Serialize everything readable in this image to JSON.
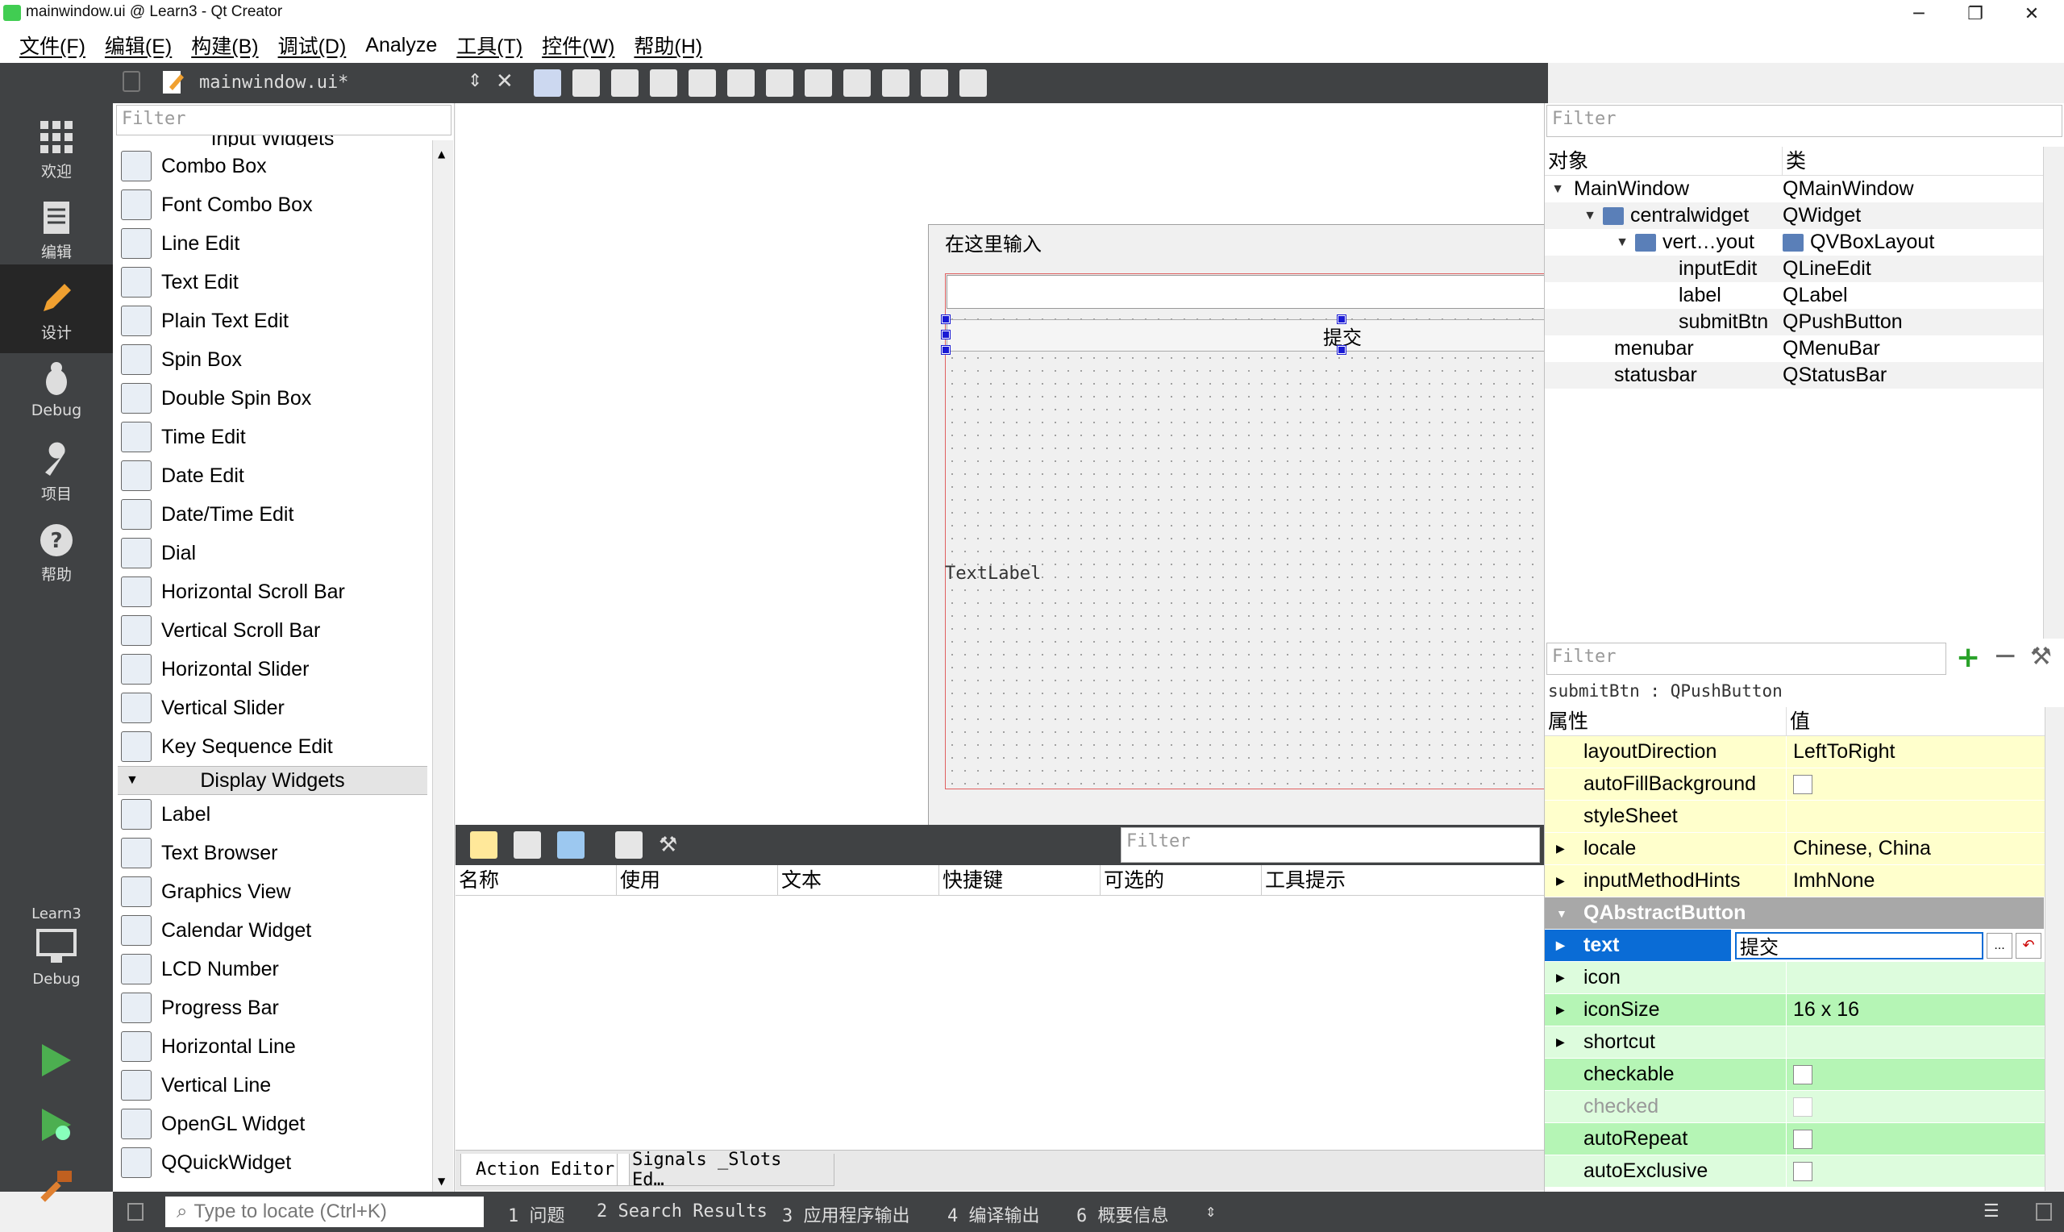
{
  "window": {
    "title": "mainwindow.ui @ Learn3 - Qt Creator"
  },
  "menu": [
    "文件(F)",
    "编辑(E)",
    "构建(B)",
    "调试(D)",
    "Analyze",
    "工具(T)",
    "控件(W)",
    "帮助(H)"
  ],
  "modes": [
    {
      "label": "欢迎",
      "icon": "grid-icon"
    },
    {
      "label": "编辑",
      "icon": "document-icon"
    },
    {
      "label": "设计",
      "icon": "pencil-icon",
      "active": true
    },
    {
      "label": "Debug",
      "icon": "bug-icon"
    },
    {
      "label": "项目",
      "icon": "wrench-icon"
    },
    {
      "label": "帮助",
      "icon": "help-icon"
    }
  ],
  "kit": {
    "project": "Learn3",
    "config": "Debug"
  },
  "toolbar": {
    "filename": "mainwindow.ui*"
  },
  "widgetbox": {
    "filter_placeholder": "Filter",
    "partial_header": "Input Widgets",
    "input_items": [
      "Combo Box",
      "Font Combo Box",
      "Line Edit",
      "Text Edit",
      "Plain Text Edit",
      "Spin Box",
      "Double Spin Box",
      "Time Edit",
      "Date Edit",
      "Date/Time Edit",
      "Dial",
      "Horizontal Scroll Bar",
      "Vertical Scroll Bar",
      "Horizontal Slider",
      "Vertical Slider",
      "Key Sequence Edit"
    ],
    "display_category": "Display Widgets",
    "display_items": [
      "Label",
      "Text Browser",
      "Graphics View",
      "Calendar Widget",
      "LCD Number",
      "Progress Bar",
      "Horizontal Line",
      "Vertical Line",
      "OpenGL Widget",
      "QQuickWidget"
    ]
  },
  "form": {
    "menu_placeholder": "在这里输入",
    "submit_text": "提交",
    "label_text": "TextLabel"
  },
  "action_editor": {
    "filter_placeholder": "Filter",
    "columns": [
      "名称",
      "使用",
      "文本",
      "快捷键",
      "可选的",
      "工具提示"
    ],
    "tabs": [
      "Action Editor",
      "Signals _Slots Ed…"
    ]
  },
  "object_inspector": {
    "filter_placeholder": "Filter",
    "col_object": "对象",
    "col_class": "类",
    "rows": [
      {
        "name": "MainWindow",
        "cls": "QMainWindow"
      },
      {
        "name": "centralwidget",
        "cls": "QWidget"
      },
      {
        "name": "vert…yout",
        "cls": "QVBoxLayout"
      },
      {
        "name": "inputEdit",
        "cls": "QLineEdit"
      },
      {
        "name": "label",
        "cls": "QLabel"
      },
      {
        "name": "submitBtn",
        "cls": "QPushButton"
      },
      {
        "name": "menubar",
        "cls": "QMenuBar"
      },
      {
        "name": "statusbar",
        "cls": "QStatusBar"
      }
    ]
  },
  "property_editor": {
    "filter_placeholder": "Filter",
    "subject": "submitBtn : QPushButton",
    "col_prop": "属性",
    "col_value": "值",
    "rows": [
      {
        "name": "layoutDirection",
        "value": "LeftToRight"
      },
      {
        "name": "autoFillBackground",
        "value": ""
      },
      {
        "name": "styleSheet",
        "value": ""
      },
      {
        "name": "locale",
        "value": "Chinese, China"
      },
      {
        "name": "inputMethodHints",
        "value": "ImhNone"
      },
      {
        "name": "QAbstractButton",
        "value": ""
      },
      {
        "name": "text",
        "value": "提交"
      },
      {
        "name": "icon",
        "value": ""
      },
      {
        "name": "iconSize",
        "value": "16 x 16"
      },
      {
        "name": "shortcut",
        "value": ""
      },
      {
        "name": "checkable",
        "value": ""
      },
      {
        "name": "checked",
        "value": ""
      },
      {
        "name": "autoRepeat",
        "value": ""
      },
      {
        "name": "autoExclusive",
        "value": ""
      }
    ]
  },
  "statusbar": {
    "locate_placeholder": "Type to locate (Ctrl+K)",
    "panes": [
      "1  问题",
      "2  Search Results",
      "3  应用程序输出",
      "4  编译输出",
      "6  概要信息"
    ]
  },
  "colors": {
    "dark": "#404244",
    "selection": "#0a6cd6",
    "yellow": "#ffffcc",
    "green": "#b5f5b5"
  }
}
